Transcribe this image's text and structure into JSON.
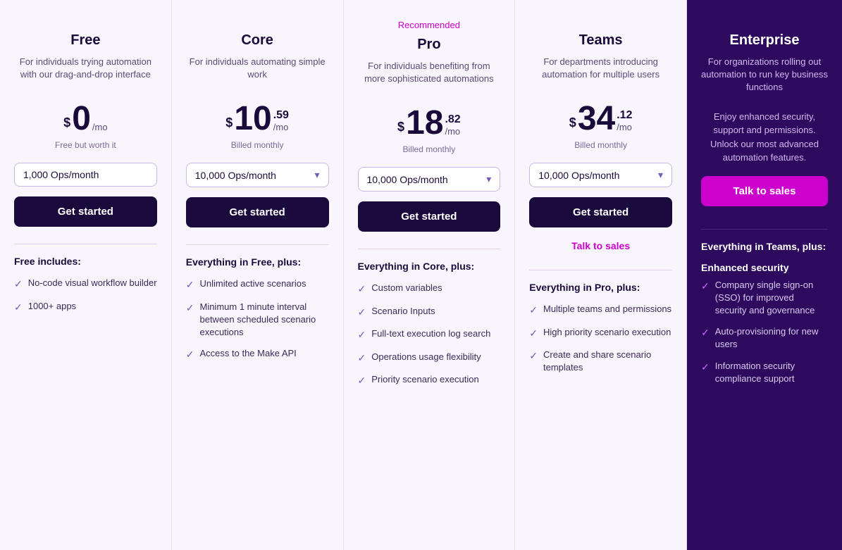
{
  "plans": [
    {
      "id": "free",
      "recommended": false,
      "name": "Free",
      "description": "For individuals trying automation with our drag-and-drop interface",
      "price_dollar": "$",
      "price_main": "0",
      "price_cents": null,
      "price_per": "/mo",
      "billing_note": "Free but worth it",
      "ops_options": "1,000 Ops/month",
      "ops_has_dropdown": false,
      "cta_label": "Get started",
      "talk_sales": false,
      "features_title": "Free includes:",
      "features": [
        "No-code visual workflow builder",
        "1000+ apps"
      ],
      "enhanced_security": null
    },
    {
      "id": "core",
      "recommended": false,
      "name": "Core",
      "description": "For individuals automating simple work",
      "price_dollar": "$",
      "price_main": "10",
      "price_cents": ".59",
      "price_per": "/mo",
      "billing_note": "Billed monthly",
      "ops_options": "10,000 Ops/month",
      "ops_has_dropdown": true,
      "cta_label": "Get started",
      "talk_sales": false,
      "features_title": "Everything in Free, plus:",
      "features": [
        "Unlimited active scenarios",
        "Minimum 1 minute interval between scheduled scenario executions",
        "Access to the Make API"
      ],
      "enhanced_security": null
    },
    {
      "id": "pro",
      "recommended": true,
      "recommended_label": "Recommended",
      "name": "Pro",
      "description": "For individuals benefiting from more sophisticated automations",
      "price_dollar": "$",
      "price_main": "18",
      "price_cents": ".82",
      "price_per": "/mo",
      "billing_note": "Billed monthly",
      "ops_options": "10,000 Ops/month",
      "ops_has_dropdown": true,
      "cta_label": "Get started",
      "talk_sales": false,
      "features_title": "Everything in Core, plus:",
      "features": [
        "Custom variables",
        "Scenario Inputs",
        "Full-text execution log search",
        "Operations usage flexibility",
        "Priority scenario execution"
      ],
      "enhanced_security": null
    },
    {
      "id": "teams",
      "recommended": false,
      "name": "Teams",
      "description": "For departments introducing automation for multiple users",
      "price_dollar": "$",
      "price_main": "34",
      "price_cents": ".12",
      "price_per": "/mo",
      "billing_note": "Billed monthly",
      "ops_options": "10,000 Ops/month",
      "ops_has_dropdown": true,
      "cta_label": "Get started",
      "talk_sales": true,
      "talk_sales_label": "Talk to sales",
      "features_title": "Everything in Pro, plus:",
      "features": [
        "Multiple teams and permissions",
        "High priority scenario execution",
        "Create and share scenario templates"
      ],
      "enhanced_security": null
    }
  ],
  "enterprise": {
    "name": "Enterprise",
    "description": "For organizations rolling out automation to run key business functions",
    "enhanced_desc": "Enjoy enhanced security, support and permissions. Unlock our most advanced automation features.",
    "cta_label": "Talk to sales",
    "features_title": "Everything in Teams, plus:",
    "enhanced_security_title": "Enhanced security",
    "features": [
      "Company single sign-on (SSO) for improved security and governance",
      "Auto-provisioning for new users",
      "Information security compliance support"
    ]
  },
  "icons": {
    "check": "✓",
    "chevron": "▾"
  }
}
